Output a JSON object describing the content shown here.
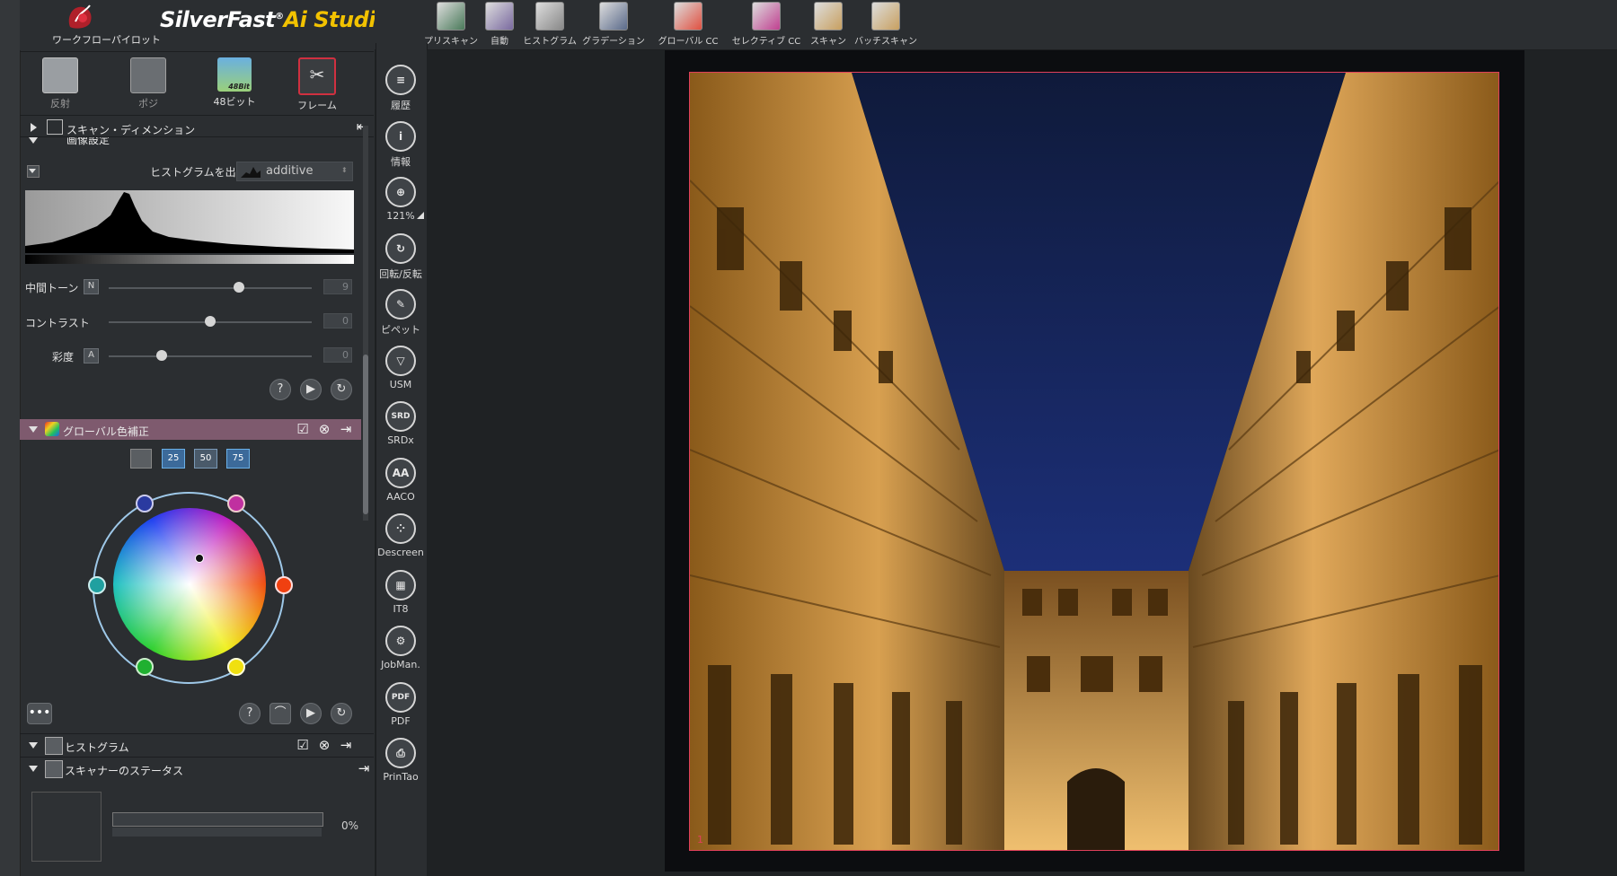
{
  "app": {
    "title_main": "SilverFast",
    "title_reg": "®",
    "title_ai": "Ai Studio",
    "workflow_pilot": "ワークフローパイロット"
  },
  "modes": [
    {
      "label": "反射",
      "active": false
    },
    {
      "label": "ポジ",
      "active": false
    },
    {
      "label": "48ビット",
      "active": true
    },
    {
      "label": "フレーム",
      "active": true
    }
  ],
  "mode_icon_text": "48Bit",
  "sections": {
    "scan_dimension": "スキャン・ディメンション",
    "image_settings": "画像設定",
    "histogram_output_label": "ヒストグラムを出力",
    "histogram_output_value": "additive",
    "global_cc": "グローバル色補正",
    "histogram": "ヒストグラム",
    "scanner_status": "スキャナーのステータス"
  },
  "sliders": [
    {
      "label": "中間トーン",
      "badge": "N",
      "value": "9",
      "level": 0.64
    },
    {
      "label": "コントラスト",
      "badge": "",
      "value": "0",
      "level": 0.5
    },
    {
      "label": "彩度",
      "badge": "A",
      "value": "0",
      "level": 0.26
    }
  ],
  "cc_steps": [
    "25",
    "50",
    "75"
  ],
  "scan_progress": "0%",
  "tools": [
    {
      "name": "history",
      "label": "履歴",
      "glyph": "≡"
    },
    {
      "name": "info",
      "label": "情報",
      "glyph": "i"
    },
    {
      "name": "zoom",
      "label": "121%",
      "glyph": "⊕"
    },
    {
      "name": "rotate",
      "label": "回転/反転",
      "glyph": "↻"
    },
    {
      "name": "pipette",
      "label": "ピペット",
      "glyph": "✎"
    },
    {
      "name": "usm",
      "label": "USM",
      "glyph": "▽"
    },
    {
      "name": "srdx",
      "label": "SRDx",
      "glyph": "SRD"
    },
    {
      "name": "aaco",
      "label": "AACO",
      "glyph": "AA"
    },
    {
      "name": "descreen",
      "label": "Descreen",
      "glyph": "⁘"
    },
    {
      "name": "it8",
      "label": "IT8",
      "glyph": "▦"
    },
    {
      "name": "jobman",
      "label": "JobMan.",
      "glyph": "⚙"
    },
    {
      "name": "pdf",
      "label": "PDF",
      "glyph": "PDF"
    },
    {
      "name": "printao",
      "label": "PrinTao",
      "glyph": "⎙"
    }
  ],
  "toolbar": [
    {
      "name": "prescan",
      "label": "プリスキャン",
      "color": "#4a7a5a"
    },
    {
      "name": "auto",
      "label": "自動",
      "color": "#7a6aa0"
    },
    {
      "name": "histogram",
      "label": "ヒストグラム",
      "color": "#888888"
    },
    {
      "name": "gradation",
      "label": "グラデーション",
      "color": "#5a6a8a"
    },
    {
      "name": "global-cc",
      "label": "グローバル CC",
      "color": "#e05040"
    },
    {
      "name": "selective-cc",
      "label": "セレクティブ CC",
      "color": "#c04090"
    },
    {
      "name": "scan",
      "label": "スキャン",
      "color": "#c8a060"
    },
    {
      "name": "batch-scan",
      "label": "バッチスキャン",
      "color": "#c8a060"
    }
  ],
  "frame_number": "1"
}
